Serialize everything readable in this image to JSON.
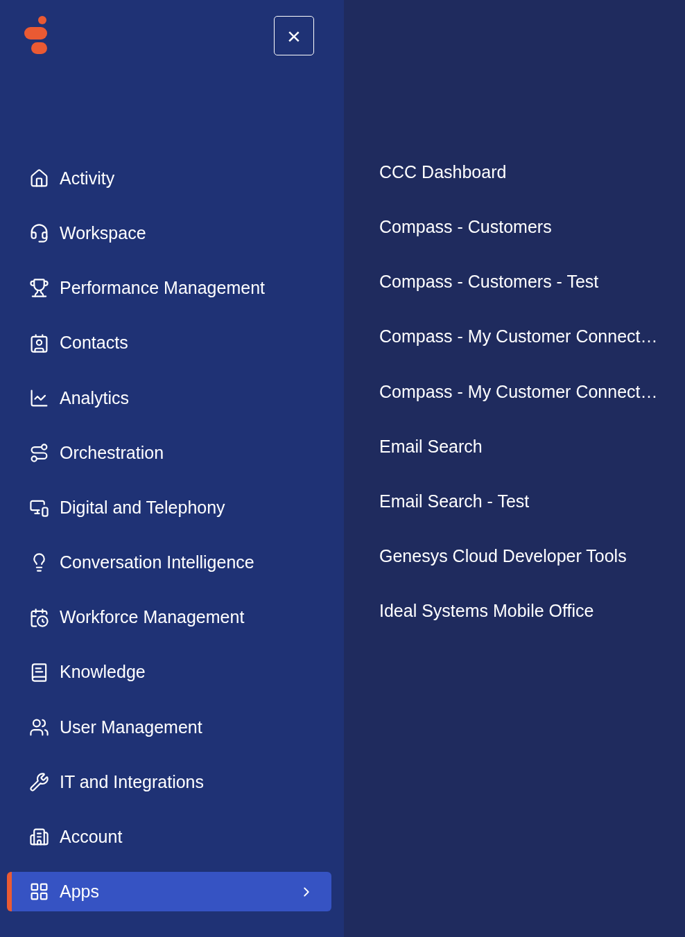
{
  "header": {
    "close_button": "×"
  },
  "nav": {
    "items": [
      {
        "label": "Activity",
        "selected": false,
        "submenu": false
      },
      {
        "label": "Workspace",
        "selected": false,
        "submenu": false
      },
      {
        "label": "Performance Management",
        "selected": false,
        "submenu": false
      },
      {
        "label": "Contacts",
        "selected": false,
        "submenu": false
      },
      {
        "label": "Analytics",
        "selected": false,
        "submenu": false
      },
      {
        "label": "Orchestration",
        "selected": false,
        "submenu": false
      },
      {
        "label": "Digital and Telephony",
        "selected": false,
        "submenu": false
      },
      {
        "label": "Conversation Intelligence",
        "selected": false,
        "submenu": false
      },
      {
        "label": "Workforce Management",
        "selected": false,
        "submenu": false
      },
      {
        "label": "Knowledge",
        "selected": false,
        "submenu": false
      },
      {
        "label": "User Management",
        "selected": false,
        "submenu": false
      },
      {
        "label": "IT and Integrations",
        "selected": false,
        "submenu": false
      },
      {
        "label": "Account",
        "selected": false,
        "submenu": false
      },
      {
        "label": "Apps",
        "selected": true,
        "submenu": true
      }
    ]
  },
  "submenu": {
    "items": [
      "CCC Dashboard",
      "Compass - Customers",
      "Compass - Customers - Test",
      "Compass - My Customer Connect…",
      "Compass - My Customer Connect…",
      "Email Search",
      "Email Search - Test",
      "Genesys Cloud Developer Tools",
      "Ideal Systems Mobile Office"
    ]
  }
}
